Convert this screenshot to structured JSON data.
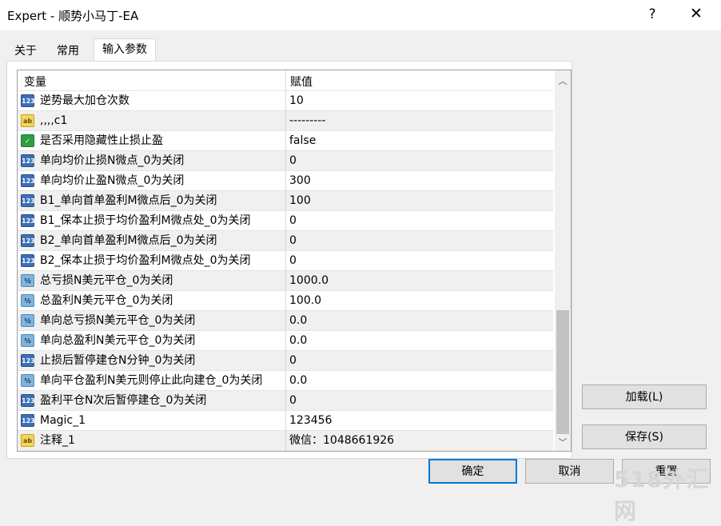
{
  "window": {
    "title": "Expert - 顺势小马丁-EA",
    "help": "?",
    "close": "✕"
  },
  "tabs": [
    "关于",
    "常用",
    "输入参数"
  ],
  "grid": {
    "col_var": "变量",
    "col_val": "赋值",
    "rows": [
      {
        "icon": "123",
        "name": "逆势最大加仓次数",
        "value": "10"
      },
      {
        "icon": "ab",
        "name": ",,,,c1",
        "value": "---------"
      },
      {
        "icon": "bool",
        "name": "是否采用隐藏性止损止盈",
        "value": "false"
      },
      {
        "icon": "123",
        "name": "单向均价止损N微点_0为关闭",
        "value": "0"
      },
      {
        "icon": "123",
        "name": "单向均价止盈N微点_0为关闭",
        "value": "300"
      },
      {
        "icon": "123",
        "name": "B1_单向首单盈利M微点后_0为关闭",
        "value": "100"
      },
      {
        "icon": "123",
        "name": "B1_保本止损于均价盈利M微点处_0为关闭",
        "value": "0"
      },
      {
        "icon": "123",
        "name": "B2_单向首单盈利M微点后_0为关闭",
        "value": "0"
      },
      {
        "icon": "123",
        "name": "B2_保本止损于均价盈利M微点处_0为关闭",
        "value": "0"
      },
      {
        "icon": "½",
        "name": "总亏损N美元平仓_0为关闭",
        "value": "1000.0"
      },
      {
        "icon": "½",
        "name": "总盈利N美元平仓_0为关闭",
        "value": "100.0"
      },
      {
        "icon": "½",
        "name": "单向总亏损N美元平仓_0为关闭",
        "value": "0.0"
      },
      {
        "icon": "½",
        "name": "单向总盈利N美元平仓_0为关闭",
        "value": "0.0"
      },
      {
        "icon": "123",
        "name": "止损后暂停建仓N分钟_0为关闭",
        "value": "0"
      },
      {
        "icon": "½",
        "name": "单向平仓盈利N美元则停止此向建仓_0为关闭",
        "value": "0.0"
      },
      {
        "icon": "123",
        "name": "盈利平仓N次后暂停建仓_0为关闭",
        "value": "0"
      },
      {
        "icon": "123",
        "name": "Magic_1",
        "value": "123456"
      },
      {
        "icon": "ab",
        "name": "注释_1",
        "value": "微信：1048661926"
      }
    ]
  },
  "buttons": {
    "load": "加载(L)",
    "save": "保存(S)",
    "ok": "确定",
    "cancel": "取消",
    "reset": "重置"
  },
  "watermark": "518外汇网"
}
